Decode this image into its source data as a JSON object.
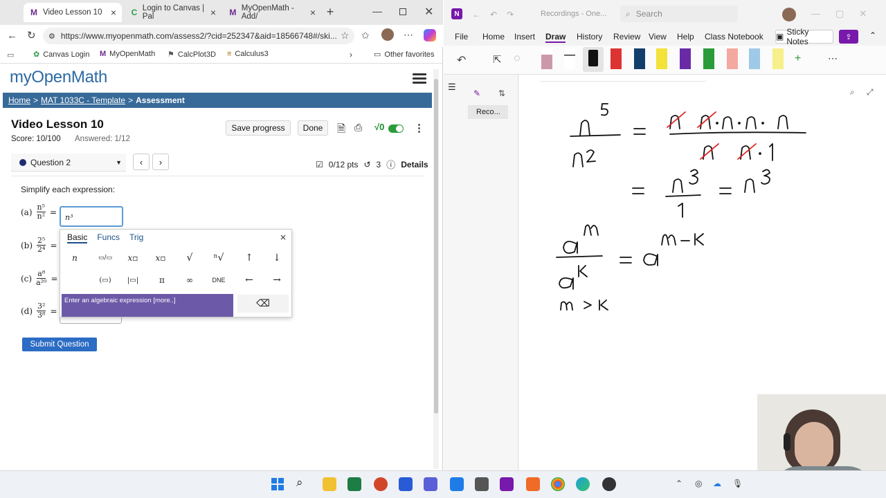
{
  "browser": {
    "tabs": [
      {
        "label": "Video Lesson 10",
        "favicon": "M",
        "active": true
      },
      {
        "label": "Login to Canvas | Pal",
        "favicon": "C",
        "active": false
      },
      {
        "label": "MyOpenMath - Add/",
        "favicon": "M",
        "active": false
      }
    ],
    "url": "https://www.myopenmath.com/assess2/?cid=252347&aid=18566748#/ski...",
    "favorites": [
      {
        "label": "Canvas Login"
      },
      {
        "label": "MyOpenMath"
      },
      {
        "label": "CalcPlot3D"
      },
      {
        "label": "Calculus3"
      }
    ],
    "other_favorites": "Other favorites"
  },
  "page": {
    "logo": "myOpenMath",
    "breadcrumb": {
      "home": "Home",
      "course": "MAT 1033C - Template",
      "current": "Assessment",
      "sep": ">"
    },
    "title": "Video Lesson 10",
    "score": "Score: 10/100",
    "answered": "Answered: 1/12",
    "save_progress": "Save progress",
    "done": "Done",
    "question_select": "Question 2",
    "points": "0/12 pts",
    "retries": "3",
    "details": "Details",
    "prompt": "Simplify each expression:",
    "parts": [
      {
        "label": "(a)",
        "num": "n⁵",
        "den": "n²",
        "answer": "n³"
      },
      {
        "label": "(b)",
        "num": "2⁵",
        "den": "2⁴"
      },
      {
        "label": "(c)",
        "num": "a⁸",
        "den": "a²⁰"
      },
      {
        "label": "(d)",
        "num": "3²",
        "den": "3⁸"
      }
    ],
    "equals": "=",
    "submit": "Submit Question",
    "mathquill": {
      "tabs": [
        "Basic",
        "Funcs",
        "Trig"
      ],
      "keys_row1": [
        "n",
        "▭/▭",
        "x▫",
        "x▫",
        "√",
        "ⁿ√",
        "↑",
        "↓"
      ],
      "keys_row2": [
        "(▭)",
        "|▭|",
        "π",
        "∞",
        "DNE",
        "←",
        "→"
      ],
      "hint": "Enter an algebraic expression [more..]",
      "backspace": "⌫",
      "close": "×"
    }
  },
  "onenote": {
    "title": "Recordings - One...",
    "search": "Search",
    "menu": [
      "File",
      "Home",
      "Insert",
      "Draw",
      "History",
      "Review",
      "View",
      "Help",
      "Class Notebook"
    ],
    "active_menu": "Draw",
    "sticky_notes": "Sticky Notes",
    "page_item": "Reco..."
  },
  "colors": {
    "breadcrumb_bg": "#376a99",
    "submit_bg": "#2b6cc4",
    "onenote_purple": "#7719aa",
    "ink_red": "#d22"
  }
}
